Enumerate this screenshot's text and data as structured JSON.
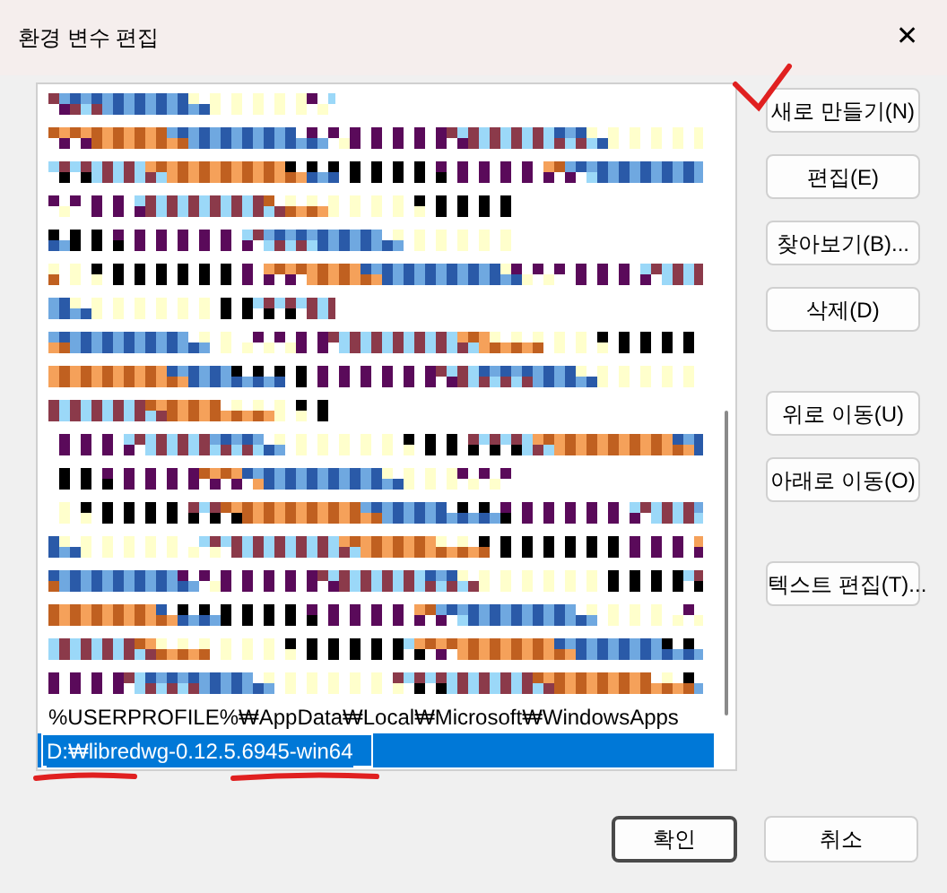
{
  "window": {
    "title": "환경 변수 편집",
    "close": "✕"
  },
  "list": {
    "rows": [
      {
        "kind": "redacted-short",
        "selected": false
      },
      {
        "kind": "redacted-long",
        "selected": false
      },
      {
        "kind": "redacted-long",
        "selected": false
      },
      {
        "kind": "redacted-medium",
        "selected": false
      },
      {
        "kind": "redacted-medium",
        "selected": false
      },
      {
        "kind": "redacted-long",
        "selected": false
      },
      {
        "kind": "redacted-short",
        "selected": false
      },
      {
        "kind": "redacted-long",
        "selected": false
      },
      {
        "kind": "redacted-long",
        "selected": false
      },
      {
        "kind": "redacted-short",
        "selected": false
      },
      {
        "kind": "redacted-long",
        "selected": false
      },
      {
        "kind": "redacted-medium",
        "selected": false
      },
      {
        "kind": "redacted-long",
        "selected": false
      },
      {
        "kind": "redacted-long",
        "selected": false
      },
      {
        "kind": "redacted-long",
        "selected": false
      },
      {
        "kind": "redacted-long",
        "selected": false
      },
      {
        "kind": "redacted-long",
        "selected": false
      },
      {
        "kind": "redacted-long",
        "selected": false
      },
      {
        "kind": "text",
        "text": "%USERPROFILE%₩AppData₩Local₩Microsoft₩WindowsApps",
        "selected": false
      },
      {
        "kind": "editing",
        "value": "D:₩libredwg-0.12.5.6945-win64",
        "selected": true
      }
    ]
  },
  "side_button_groups": [
    [
      "새로 만들기(N)",
      "편집(E)",
      "찾아보기(B)...",
      "삭제(D)"
    ],
    [
      "위로 이동(U)",
      "아래로 이동(O)"
    ],
    [
      "텍스트 편집(T)..."
    ]
  ],
  "footer_buttons": [
    "확인",
    "취소"
  ],
  "annotations": [
    {
      "kind": "checkmark"
    },
    {
      "kind": "underline-left"
    },
    {
      "kind": "underline-right"
    }
  ]
}
